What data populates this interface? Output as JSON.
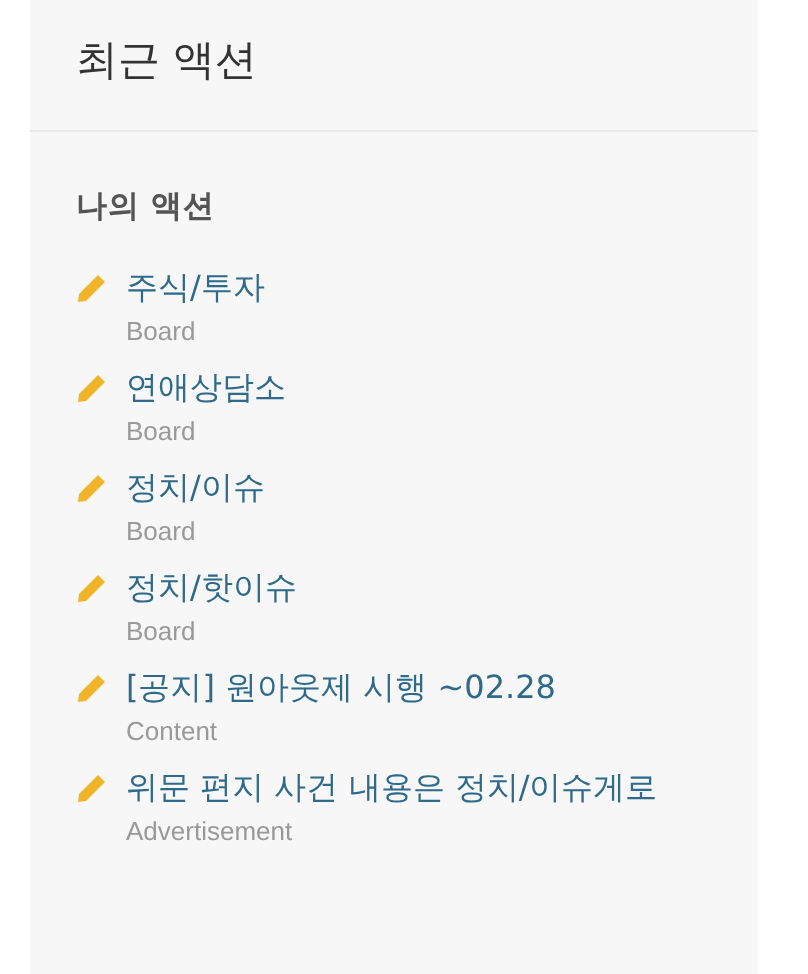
{
  "panel": {
    "title": "최근 액션",
    "section_heading": "나의 액션",
    "items": [
      {
        "title": "주식/투자",
        "type": "Board"
      },
      {
        "title": "연애상담소",
        "type": "Board"
      },
      {
        "title": "정치/이슈",
        "type": "Board"
      },
      {
        "title": "정치/핫이슈",
        "type": "Board"
      },
      {
        "title": "[공지] 원아웃제 시행 ~02.28",
        "type": "Content"
      },
      {
        "title": "위문 편지 사건 내용은 정치/이슈게로",
        "type": "Advertisement"
      }
    ]
  }
}
